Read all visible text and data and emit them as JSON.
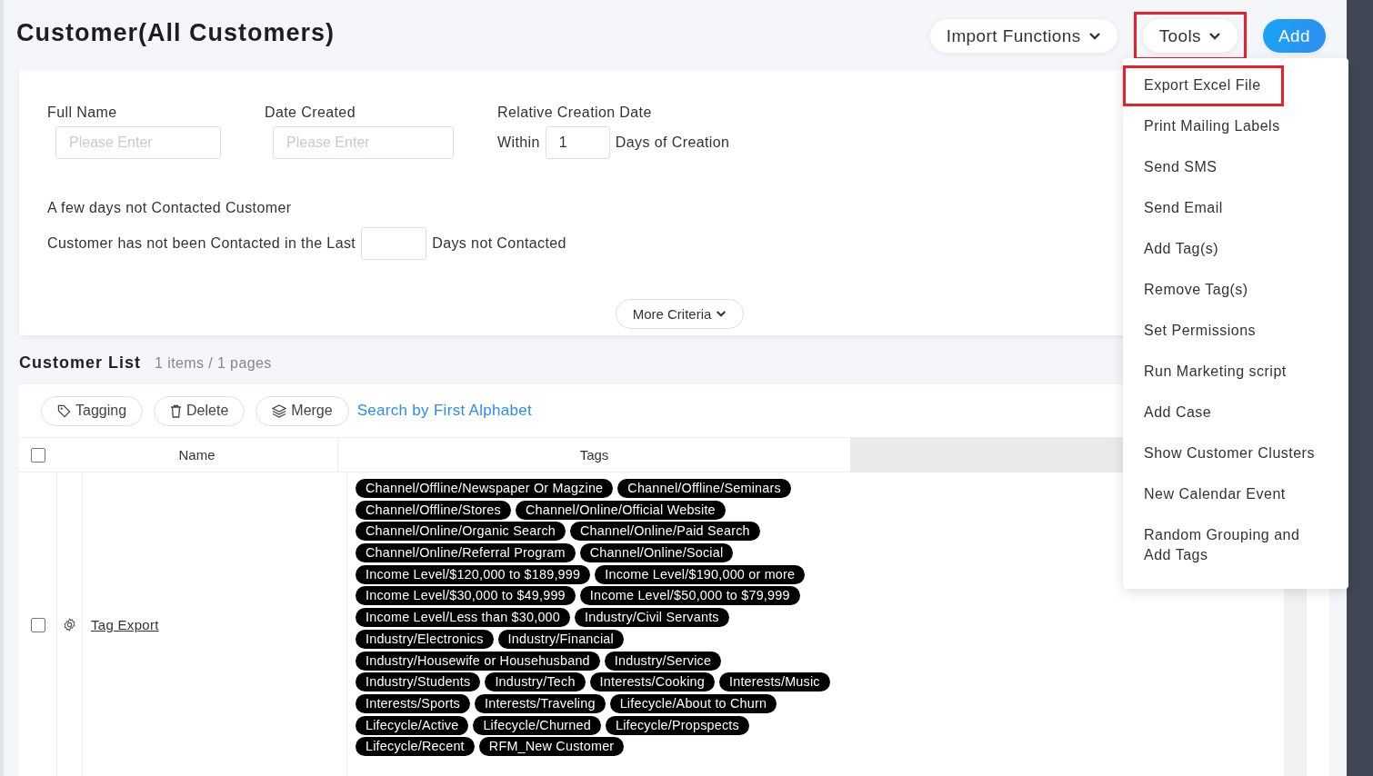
{
  "title": "Customer(All Customers)",
  "header_buttons": [
    {
      "label": "Import Functions",
      "kind": "dropdown",
      "highlighted": false
    },
    {
      "label": "Tools",
      "kind": "dropdown",
      "highlighted": true
    },
    {
      "label": "Add",
      "kind": "primary",
      "highlighted": false
    }
  ],
  "filters": {
    "full_name": {
      "label": "Full Name",
      "placeholder": "Please Enter"
    },
    "date_created": {
      "label": "Date Created",
      "placeholder": "Please Enter"
    },
    "relative": {
      "label": "Relative Creation Date",
      "prefix": "Within",
      "value": "1",
      "suffix": "Days of Creation"
    },
    "not_contacted": {
      "label": "A few days not Contacted Customer",
      "prefix": "Customer has not been Contacted in the Last",
      "suffix": "Days not Contacted"
    },
    "more": "More Criteria"
  },
  "list": {
    "title": "Customer List",
    "count": "1 items / 1 pages"
  },
  "toolbar": [
    {
      "label": "Tagging",
      "kind": "tag"
    },
    {
      "label": "Delete",
      "kind": "trash"
    },
    {
      "label": "Merge",
      "kind": "layers"
    }
  ],
  "alphabet_link": "Search by First Alphabet",
  "table": {
    "select_all": {
      "checked": false
    },
    "columns": [
      "Name",
      "Tags"
    ],
    "rows": [
      {
        "checked": false,
        "name": "Tag Export",
        "tags": [
          "Channel/Offline/Newspaper Or Magzine",
          "Channel/Offline/Seminars",
          "Channel/Offline/Stores",
          "Channel/Online/Official Website",
          "Channel/Online/Organic Search",
          "Channel/Online/Paid Search",
          "Channel/Online/Referral Program",
          "Channel/Online/Social",
          "Income Level/$120,000 to $189,999",
          "Income Level/$190,000 or more",
          "Income Level/$30,000 to $49,999",
          "Income Level/$50,000 to $79,999",
          "Income Level/Less than $30,000",
          "Industry/Civil Servants",
          "Industry/Electronics",
          "Industry/Financial",
          "Industry/Housewife or Househusband",
          "Industry/Service",
          "Industry/Students",
          "Industry/Tech",
          "Interests/Cooking",
          "Interests/Music",
          "Interests/Sports",
          "Interests/Traveling",
          "Lifecycle/About to Churn",
          "Lifecycle/Active",
          "Lifecycle/Churned",
          "Lifecycle/Propspects",
          "Lifecycle/Recent",
          "RFM_New Customer"
        ]
      }
    ]
  },
  "tools_menu": [
    {
      "label": "Export Excel File",
      "highlighted": true
    },
    {
      "label": "Print Mailing Labels",
      "highlighted": false
    },
    {
      "label": "Send SMS",
      "highlighted": false
    },
    {
      "label": "Send Email",
      "highlighted": false
    },
    {
      "label": "Add Tag(s)",
      "highlighted": false
    },
    {
      "label": "Remove Tag(s)",
      "highlighted": false
    },
    {
      "label": "Set Permissions",
      "highlighted": false
    },
    {
      "label": "Run Marketing script",
      "highlighted": false
    },
    {
      "label": "Add Case",
      "highlighted": false
    },
    {
      "label": "Show Customer Clusters",
      "highlighted": false
    },
    {
      "label": "New Calendar Event",
      "highlighted": false
    },
    {
      "label": "Random Grouping and Add Tags",
      "highlighted": false
    }
  ]
}
